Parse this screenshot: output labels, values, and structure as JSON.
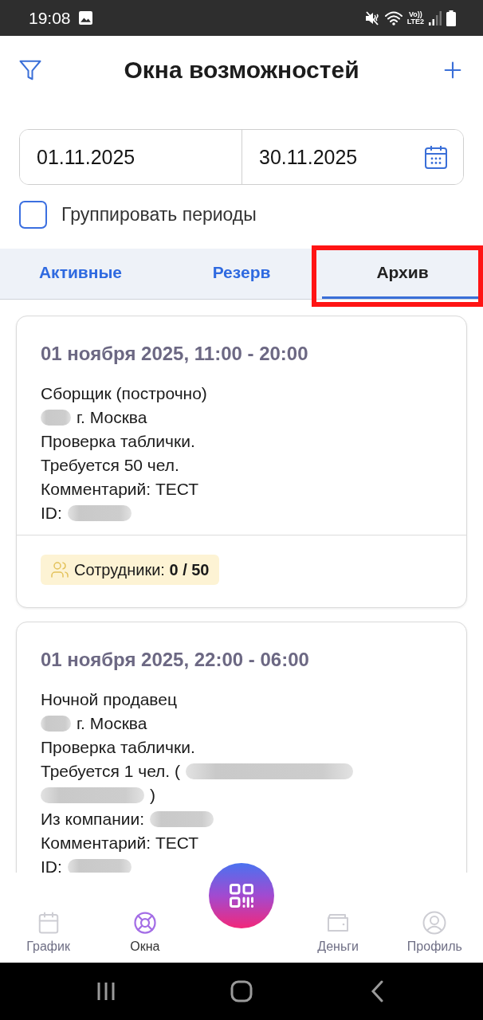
{
  "status_bar": {
    "time": "19:08",
    "volte_label": "Vo))",
    "network_label": "LTE2"
  },
  "header": {
    "title": "Окна возможностей"
  },
  "date_range": {
    "from": "01.11.2025",
    "to": "30.11.2025"
  },
  "group_periods": {
    "label": "Группировать периоды",
    "checked": false
  },
  "tabs": [
    {
      "label": "Активные",
      "selected": false,
      "highlighted": false
    },
    {
      "label": "Резерв",
      "selected": false,
      "highlighted": false
    },
    {
      "label": "Архив",
      "selected": true,
      "highlighted": true
    }
  ],
  "cards": [
    {
      "title": "01 ноября 2025, 11:00 - 20:00",
      "lines": [
        [
          {
            "kind": "text",
            "text": "Сборщик (построчно)"
          }
        ],
        [
          {
            "kind": "redacted-short"
          },
          {
            "kind": "text",
            "text": "г. Москва"
          }
        ],
        [
          {
            "kind": "text",
            "text": "Проверка таблички."
          }
        ],
        [
          {
            "kind": "text",
            "text": "Требуется 50 чел."
          }
        ],
        [
          {
            "kind": "text",
            "text": "Комментарий: ТЕСТ"
          }
        ],
        [
          {
            "kind": "text",
            "text": "ID:"
          },
          {
            "kind": "redacted-medium"
          }
        ]
      ],
      "staff_text": "Сотрудники: **0 / 50**"
    },
    {
      "title": "01 ноября 2025, 22:00 - 06:00",
      "lines": [
        [
          {
            "kind": "text",
            "text": "Ночной продавец"
          }
        ],
        [
          {
            "kind": "redacted-short"
          },
          {
            "kind": "text",
            "text": "г. Москва"
          }
        ],
        [
          {
            "kind": "text",
            "text": "Проверка таблички."
          }
        ],
        [
          {
            "kind": "text",
            "text": "Требуется 1 чел. ("
          },
          {
            "kind": "redacted-long"
          }
        ],
        [
          {
            "kind": "redacted-wide"
          },
          {
            "kind": "text",
            "text": ")"
          }
        ],
        [
          {
            "kind": "text",
            "text": "Из компании:"
          },
          {
            "kind": "redacted-medium"
          }
        ],
        [
          {
            "kind": "text",
            "text": "Комментарий: ТЕСТ"
          }
        ],
        [
          {
            "kind": "text",
            "text": "ID:"
          },
          {
            "kind": "redacted-medium"
          }
        ]
      ]
    }
  ],
  "bottom_nav": {
    "items": [
      {
        "kind": "calendar",
        "label": "График",
        "selected": false
      },
      {
        "kind": "lifebuoy",
        "label": "Окна",
        "selected": true
      },
      {
        "kind": "wallet",
        "label": "Деньги",
        "selected": false
      },
      {
        "kind": "profile",
        "label": "Профиль",
        "selected": false
      }
    ]
  }
}
